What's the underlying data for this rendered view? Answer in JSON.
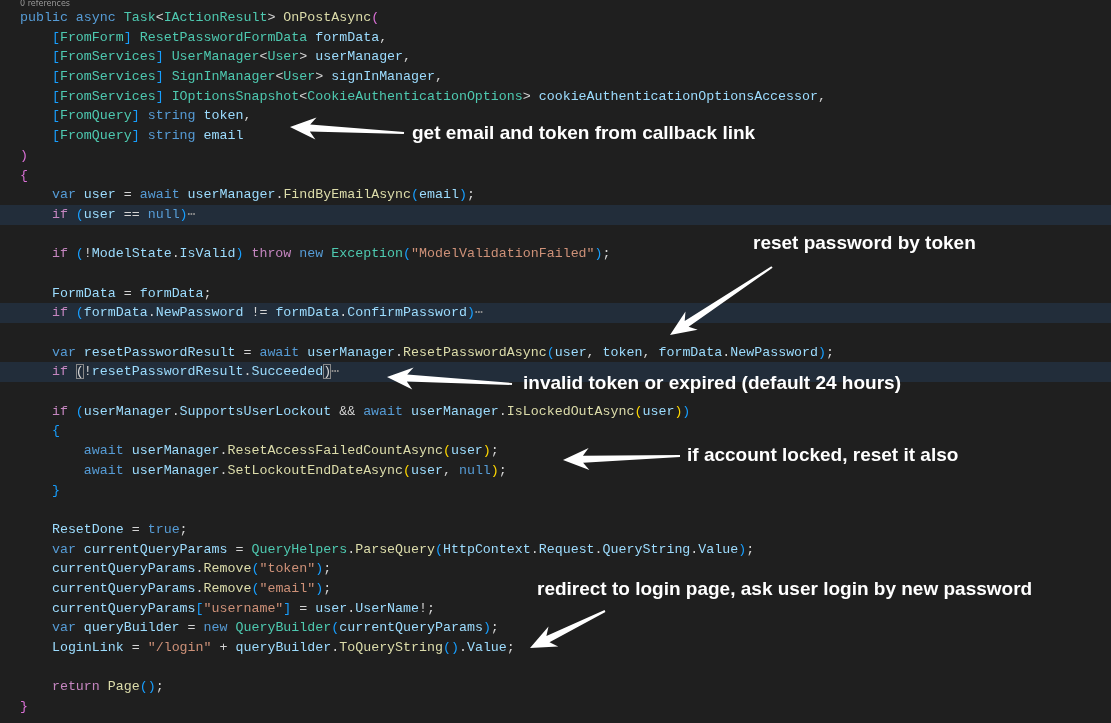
{
  "editor": {
    "codelens": "0 references",
    "lines": [
      {
        "highlighted": false,
        "tokens": [
          {
            "kind": "kw",
            "text": "public async "
          },
          {
            "kind": "type",
            "text": "Task"
          },
          {
            "kind": "punc",
            "text": "<"
          },
          {
            "kind": "type",
            "text": "IActionResult"
          },
          {
            "kind": "punc",
            "text": "> "
          },
          {
            "kind": "fn",
            "text": "OnPostAsync"
          },
          {
            "kind": "p2",
            "text": "("
          }
        ]
      },
      {
        "highlighted": false,
        "tokens": [
          {
            "kind": "p3",
            "text": "    ["
          },
          {
            "kind": "type",
            "text": "FromForm"
          },
          {
            "kind": "p3",
            "text": "] "
          },
          {
            "kind": "type",
            "text": "ResetPasswordFormData"
          },
          {
            "kind": "var",
            "text": " formData"
          },
          {
            "kind": "punc",
            "text": ","
          }
        ]
      },
      {
        "highlighted": false,
        "tokens": [
          {
            "kind": "p3",
            "text": "    ["
          },
          {
            "kind": "type",
            "text": "FromServices"
          },
          {
            "kind": "p3",
            "text": "] "
          },
          {
            "kind": "type",
            "text": "UserManager"
          },
          {
            "kind": "punc",
            "text": "<"
          },
          {
            "kind": "type",
            "text": "User"
          },
          {
            "kind": "punc",
            "text": "> "
          },
          {
            "kind": "var",
            "text": "userManager"
          },
          {
            "kind": "punc",
            "text": ","
          }
        ]
      },
      {
        "highlighted": false,
        "tokens": [
          {
            "kind": "p3",
            "text": "    ["
          },
          {
            "kind": "type",
            "text": "FromServices"
          },
          {
            "kind": "p3",
            "text": "] "
          },
          {
            "kind": "type",
            "text": "SignInManager"
          },
          {
            "kind": "punc",
            "text": "<"
          },
          {
            "kind": "type",
            "text": "User"
          },
          {
            "kind": "punc",
            "text": "> "
          },
          {
            "kind": "var",
            "text": "signInManager"
          },
          {
            "kind": "punc",
            "text": ","
          }
        ]
      },
      {
        "highlighted": false,
        "tokens": [
          {
            "kind": "p3",
            "text": "    ["
          },
          {
            "kind": "type",
            "text": "FromServices"
          },
          {
            "kind": "p3",
            "text": "] "
          },
          {
            "kind": "type",
            "text": "IOptionsSnapshot"
          },
          {
            "kind": "punc",
            "text": "<"
          },
          {
            "kind": "type",
            "text": "CookieAuthenticationOptions"
          },
          {
            "kind": "punc",
            "text": "> "
          },
          {
            "kind": "var",
            "text": "cookieAuthenticationOptionsAccessor"
          },
          {
            "kind": "punc",
            "text": ","
          }
        ]
      },
      {
        "highlighted": false,
        "tokens": [
          {
            "kind": "p3",
            "text": "    ["
          },
          {
            "kind": "type",
            "text": "FromQuery"
          },
          {
            "kind": "p3",
            "text": "] "
          },
          {
            "kind": "kw",
            "text": "string "
          },
          {
            "kind": "var",
            "text": "token"
          },
          {
            "kind": "punc",
            "text": ","
          }
        ]
      },
      {
        "highlighted": false,
        "tokens": [
          {
            "kind": "p3",
            "text": "    ["
          },
          {
            "kind": "type",
            "text": "FromQuery"
          },
          {
            "kind": "p3",
            "text": "] "
          },
          {
            "kind": "kw",
            "text": "string "
          },
          {
            "kind": "var",
            "text": "email"
          }
        ]
      },
      {
        "highlighted": false,
        "tokens": [
          {
            "kind": "p2",
            "text": ")"
          }
        ]
      },
      {
        "highlighted": false,
        "tokens": [
          {
            "kind": "p2",
            "text": "{"
          }
        ]
      },
      {
        "highlighted": false,
        "tokens": [
          {
            "kind": "kw",
            "text": "    var "
          },
          {
            "kind": "var",
            "text": "user"
          },
          {
            "kind": "punc",
            "text": " = "
          },
          {
            "kind": "kw",
            "text": "await "
          },
          {
            "kind": "var",
            "text": "userManager"
          },
          {
            "kind": "punc",
            "text": "."
          },
          {
            "kind": "fn",
            "text": "FindByEmailAsync"
          },
          {
            "kind": "p3",
            "text": "("
          },
          {
            "kind": "var",
            "text": "email"
          },
          {
            "kind": "p3",
            "text": ")"
          },
          {
            "kind": "punc",
            "text": ";"
          }
        ]
      },
      {
        "highlighted": true,
        "tokens": [
          {
            "kind": "ctl",
            "text": "    if "
          },
          {
            "kind": "p3",
            "text": "("
          },
          {
            "kind": "var",
            "text": "user"
          },
          {
            "kind": "punc",
            "text": " == "
          },
          {
            "kind": "kw",
            "text": "null"
          },
          {
            "kind": "p3",
            "text": ")"
          },
          {
            "kind": "fold",
            "text": "⋯"
          }
        ]
      },
      {
        "highlighted": false
      },
      {
        "highlighted": false,
        "tokens": [
          {
            "kind": "ctl",
            "text": "    if "
          },
          {
            "kind": "p3",
            "text": "("
          },
          {
            "kind": "punc",
            "text": "!"
          },
          {
            "kind": "var",
            "text": "ModelState"
          },
          {
            "kind": "punc",
            "text": "."
          },
          {
            "kind": "var",
            "text": "IsValid"
          },
          {
            "kind": "p3",
            "text": ")"
          },
          {
            "kind": "ctl",
            "text": " throw "
          },
          {
            "kind": "kw",
            "text": "new "
          },
          {
            "kind": "type",
            "text": "Exception"
          },
          {
            "kind": "p3",
            "text": "("
          },
          {
            "kind": "str",
            "text": "\"ModelValidationFailed\""
          },
          {
            "kind": "p3",
            "text": ")"
          },
          {
            "kind": "punc",
            "text": ";"
          }
        ]
      },
      {
        "highlighted": false
      },
      {
        "highlighted": false,
        "tokens": [
          {
            "kind": "var",
            "text": "    FormData"
          },
          {
            "kind": "punc",
            "text": " = "
          },
          {
            "kind": "var",
            "text": "formData"
          },
          {
            "kind": "punc",
            "text": ";"
          }
        ]
      },
      {
        "highlighted": true,
        "tokens": [
          {
            "kind": "ctl",
            "text": "    if "
          },
          {
            "kind": "p3",
            "text": "("
          },
          {
            "kind": "var",
            "text": "formData"
          },
          {
            "kind": "punc",
            "text": "."
          },
          {
            "kind": "var",
            "text": "NewPassword"
          },
          {
            "kind": "punc",
            "text": " != "
          },
          {
            "kind": "var",
            "text": "formData"
          },
          {
            "kind": "punc",
            "text": "."
          },
          {
            "kind": "var",
            "text": "ConfirmPassword"
          },
          {
            "kind": "p3",
            "text": ")"
          },
          {
            "kind": "fold",
            "text": "⋯"
          }
        ]
      },
      {
        "highlighted": false
      },
      {
        "highlighted": false,
        "tokens": [
          {
            "kind": "kw",
            "text": "    var "
          },
          {
            "kind": "var",
            "text": "resetPasswordResult"
          },
          {
            "kind": "punc",
            "text": " = "
          },
          {
            "kind": "kw",
            "text": "await "
          },
          {
            "kind": "var",
            "text": "userManager"
          },
          {
            "kind": "punc",
            "text": "."
          },
          {
            "kind": "fn",
            "text": "ResetPasswordAsync"
          },
          {
            "kind": "p3",
            "text": "("
          },
          {
            "kind": "var",
            "text": "user"
          },
          {
            "kind": "punc",
            "text": ", "
          },
          {
            "kind": "var",
            "text": "token"
          },
          {
            "kind": "punc",
            "text": ", "
          },
          {
            "kind": "var",
            "text": "formData"
          },
          {
            "kind": "punc",
            "text": "."
          },
          {
            "kind": "var",
            "text": "NewPassword"
          },
          {
            "kind": "p3",
            "text": ")"
          },
          {
            "kind": "punc",
            "text": ";"
          }
        ]
      },
      {
        "highlighted": true,
        "tokens": [
          {
            "kind": "ctl",
            "text": "    if "
          },
          {
            "kind": "bmatch",
            "text": "("
          },
          {
            "kind": "punc",
            "text": "!"
          },
          {
            "kind": "var",
            "text": "resetPasswordResult"
          },
          {
            "kind": "punc",
            "text": "."
          },
          {
            "kind": "var",
            "text": "Succeeded"
          },
          {
            "kind": "bmatch",
            "text": ")"
          },
          {
            "kind": "fold",
            "text": "⋯"
          }
        ]
      },
      {
        "highlighted": false
      },
      {
        "highlighted": false,
        "tokens": [
          {
            "kind": "ctl",
            "text": "    if "
          },
          {
            "kind": "p3",
            "text": "("
          },
          {
            "kind": "var",
            "text": "userManager"
          },
          {
            "kind": "punc",
            "text": "."
          },
          {
            "kind": "var",
            "text": "SupportsUserLockout"
          },
          {
            "kind": "punc",
            "text": " && "
          },
          {
            "kind": "kw",
            "text": "await "
          },
          {
            "kind": "var",
            "text": "userManager"
          },
          {
            "kind": "punc",
            "text": "."
          },
          {
            "kind": "fn",
            "text": "IsLockedOutAsync"
          },
          {
            "kind": "p1",
            "text": "("
          },
          {
            "kind": "var",
            "text": "user"
          },
          {
            "kind": "p1",
            "text": ")"
          },
          {
            "kind": "p3",
            "text": ")"
          }
        ]
      },
      {
        "highlighted": false,
        "tokens": [
          {
            "kind": "p3",
            "text": "    {"
          }
        ]
      },
      {
        "highlighted": false,
        "tokens": [
          {
            "kind": "kw",
            "text": "        await "
          },
          {
            "kind": "var",
            "text": "userManager"
          },
          {
            "kind": "punc",
            "text": "."
          },
          {
            "kind": "fn",
            "text": "ResetAccessFailedCountAsync"
          },
          {
            "kind": "p1",
            "text": "("
          },
          {
            "kind": "var",
            "text": "user"
          },
          {
            "kind": "p1",
            "text": ")"
          },
          {
            "kind": "punc",
            "text": ";"
          }
        ]
      },
      {
        "highlighted": false,
        "tokens": [
          {
            "kind": "kw",
            "text": "        await "
          },
          {
            "kind": "var",
            "text": "userManager"
          },
          {
            "kind": "punc",
            "text": "."
          },
          {
            "kind": "fn",
            "text": "SetLockoutEndDateAsync"
          },
          {
            "kind": "p1",
            "text": "("
          },
          {
            "kind": "var",
            "text": "user"
          },
          {
            "kind": "punc",
            "text": ", "
          },
          {
            "kind": "kw",
            "text": "null"
          },
          {
            "kind": "p1",
            "text": ")"
          },
          {
            "kind": "punc",
            "text": ";"
          }
        ]
      },
      {
        "highlighted": false,
        "tokens": [
          {
            "kind": "p3",
            "text": "    }"
          }
        ]
      },
      {
        "highlighted": false
      },
      {
        "highlighted": false,
        "tokens": [
          {
            "kind": "var",
            "text": "    ResetDone"
          },
          {
            "kind": "punc",
            "text": " = "
          },
          {
            "kind": "kw",
            "text": "true"
          },
          {
            "kind": "punc",
            "text": ";"
          }
        ]
      },
      {
        "highlighted": false,
        "tokens": [
          {
            "kind": "kw",
            "text": "    var "
          },
          {
            "kind": "var",
            "text": "currentQueryParams"
          },
          {
            "kind": "punc",
            "text": " = "
          },
          {
            "kind": "type",
            "text": "QueryHelpers"
          },
          {
            "kind": "punc",
            "text": "."
          },
          {
            "kind": "fn",
            "text": "ParseQuery"
          },
          {
            "kind": "p3",
            "text": "("
          },
          {
            "kind": "var",
            "text": "HttpContext"
          },
          {
            "kind": "punc",
            "text": "."
          },
          {
            "kind": "var",
            "text": "Request"
          },
          {
            "kind": "punc",
            "text": "."
          },
          {
            "kind": "var",
            "text": "QueryString"
          },
          {
            "kind": "punc",
            "text": "."
          },
          {
            "kind": "var",
            "text": "Value"
          },
          {
            "kind": "p3",
            "text": ")"
          },
          {
            "kind": "punc",
            "text": ";"
          }
        ]
      },
      {
        "highlighted": false,
        "tokens": [
          {
            "kind": "var",
            "text": "    currentQueryParams"
          },
          {
            "kind": "punc",
            "text": "."
          },
          {
            "kind": "fn",
            "text": "Remove"
          },
          {
            "kind": "p3",
            "text": "("
          },
          {
            "kind": "str",
            "text": "\"token\""
          },
          {
            "kind": "p3",
            "text": ")"
          },
          {
            "kind": "punc",
            "text": ";"
          }
        ]
      },
      {
        "highlighted": false,
        "tokens": [
          {
            "kind": "var",
            "text": "    currentQueryParams"
          },
          {
            "kind": "punc",
            "text": "."
          },
          {
            "kind": "fn",
            "text": "Remove"
          },
          {
            "kind": "p3",
            "text": "("
          },
          {
            "kind": "str",
            "text": "\"email\""
          },
          {
            "kind": "p3",
            "text": ")"
          },
          {
            "kind": "punc",
            "text": ";"
          }
        ]
      },
      {
        "highlighted": false,
        "tokens": [
          {
            "kind": "var",
            "text": "    currentQueryParams"
          },
          {
            "kind": "p3",
            "text": "["
          },
          {
            "kind": "str",
            "text": "\"username\""
          },
          {
            "kind": "p3",
            "text": "]"
          },
          {
            "kind": "punc",
            "text": " = "
          },
          {
            "kind": "var",
            "text": "user"
          },
          {
            "kind": "punc",
            "text": "."
          },
          {
            "kind": "var",
            "text": "UserName"
          },
          {
            "kind": "punc",
            "text": "!;"
          }
        ]
      },
      {
        "highlighted": false,
        "tokens": [
          {
            "kind": "kw",
            "text": "    var "
          },
          {
            "kind": "var",
            "text": "queryBuilder"
          },
          {
            "kind": "punc",
            "text": " = "
          },
          {
            "kind": "kw",
            "text": "new "
          },
          {
            "kind": "type",
            "text": "QueryBuilder"
          },
          {
            "kind": "p3",
            "text": "("
          },
          {
            "kind": "var",
            "text": "currentQueryParams"
          },
          {
            "kind": "p3",
            "text": ")"
          },
          {
            "kind": "punc",
            "text": ";"
          }
        ]
      },
      {
        "highlighted": false,
        "tokens": [
          {
            "kind": "var",
            "text": "    LoginLink"
          },
          {
            "kind": "punc",
            "text": " = "
          },
          {
            "kind": "str",
            "text": "\"/login\""
          },
          {
            "kind": "punc",
            "text": " + "
          },
          {
            "kind": "var",
            "text": "queryBuilder"
          },
          {
            "kind": "punc",
            "text": "."
          },
          {
            "kind": "fn",
            "text": "ToQueryString"
          },
          {
            "kind": "p3",
            "text": "()"
          },
          {
            "kind": "punc",
            "text": "."
          },
          {
            "kind": "var",
            "text": "Value"
          },
          {
            "kind": "punc",
            "text": ";"
          }
        ]
      },
      {
        "highlighted": false
      },
      {
        "highlighted": false,
        "tokens": [
          {
            "kind": "ctl",
            "text": "    return "
          },
          {
            "kind": "fn",
            "text": "Page"
          },
          {
            "kind": "p3",
            "text": "()"
          },
          {
            "kind": "punc",
            "text": ";"
          }
        ]
      },
      {
        "highlighted": false,
        "tokens": [
          {
            "kind": "p2",
            "text": "}"
          }
        ]
      }
    ]
  },
  "annotations": [
    {
      "text": "get email and token from callback link"
    },
    {
      "text": "reset password by token"
    },
    {
      "text": "invalid token or expired (default 24 hours)"
    },
    {
      "text": "if account locked, reset it also"
    },
    {
      "text": "redirect to login page, ask user login by new password"
    }
  ]
}
